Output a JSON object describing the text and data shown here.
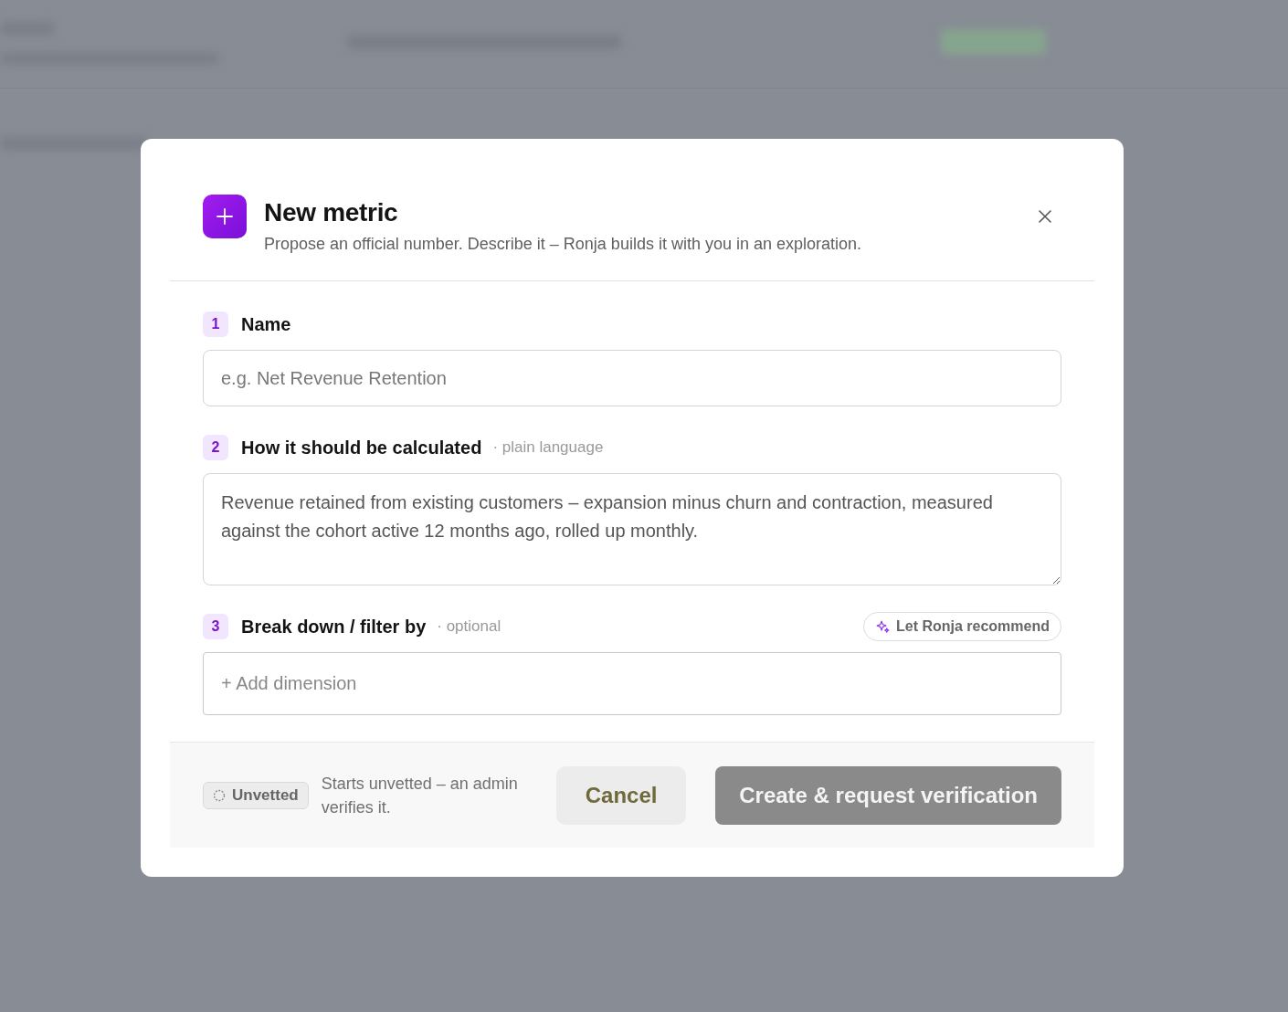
{
  "dialog": {
    "title": "New metric",
    "subtitle": "Propose an official number. Describe it – Ronja builds it with you in an exploration.",
    "steps": [
      {
        "number": "1",
        "label": "Name",
        "kind": "input",
        "placeholder": "e.g. Net Revenue Retention"
      },
      {
        "number": "2",
        "label": "How it should be calculated",
        "hint": "· plain language",
        "kind": "textarea",
        "value": "Revenue retained from existing customers – expansion minus churn and contraction, measured against the cohort active 12 months ago, rolled up monthly."
      },
      {
        "number": "3",
        "label": "Break down / filter by",
        "hint": "· optional",
        "kind": "dimension",
        "action": "Let Ronja recommend",
        "placeholder": "+ Add dimension"
      }
    ],
    "footer": {
      "status_badge": "Unvetted",
      "note": "Starts unvetted – an admin verifies it.",
      "cancel": "Cancel",
      "submit": {
        "label": "Create & request verification",
        "disabled": true
      }
    }
  }
}
